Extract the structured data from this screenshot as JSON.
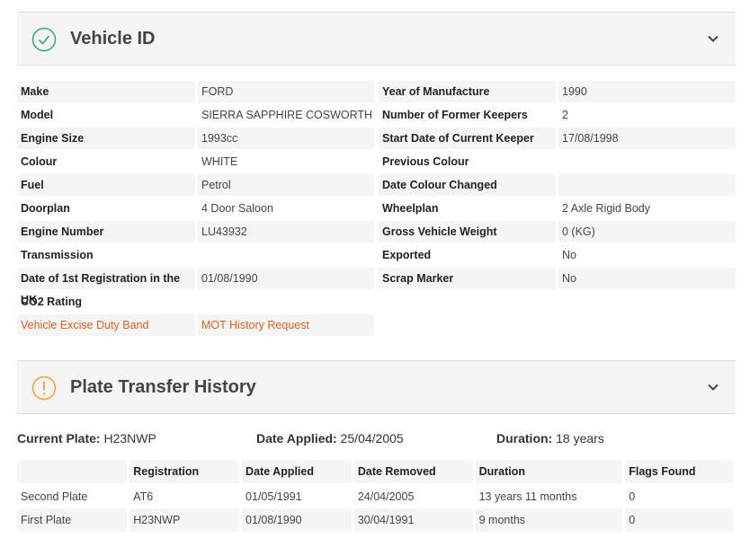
{
  "vehicle_id": {
    "title": "Vehicle ID",
    "rows": [
      {
        "l1": "Make",
        "v1": "FORD",
        "l2": "Year of Manufacture",
        "v2": "1990"
      },
      {
        "l1": "Model",
        "v1": "SIERRA SAPPHIRE COSWORTH",
        "l2": "Number of Former Keepers",
        "v2": "2"
      },
      {
        "l1": "Engine Size",
        "v1": "1993cc",
        "l2": "Start Date of Current Keeper",
        "v2": "17/08/1998"
      },
      {
        "l1": "Colour",
        "v1": "WHITE",
        "l2": "Previous Colour",
        "v2": ""
      },
      {
        "l1": "Fuel",
        "v1": "Petrol",
        "l2": "Date Colour Changed",
        "v2": ""
      },
      {
        "l1": "Doorplan",
        "v1": "4 Door Saloon",
        "l2": "Wheelplan",
        "v2": "2 Axle Rigid Body"
      },
      {
        "l1": "Engine Number",
        "v1": "LU43932",
        "l2": "Gross Vehicle Weight",
        "v2": "0 (KG)"
      },
      {
        "l1": "Transmission",
        "v1": "",
        "l2": "Exported",
        "v2": "No"
      },
      {
        "l1": "Date of 1st Registration in the UK",
        "v1": "01/08/1990",
        "l2": "Scrap Marker",
        "v2": "No"
      },
      {
        "l1": "CO2 Rating",
        "v1": "",
        "l2": "",
        "v2": ""
      }
    ],
    "links": {
      "ved_band": "Vehicle Excise Duty Band",
      "mot_history": "MOT History Request"
    }
  },
  "plate_transfer": {
    "title": "Plate Transfer History",
    "current_plate_label": "Current Plate:",
    "current_plate": "H23NWP",
    "date_applied_label": "Date Applied:",
    "date_applied": "25/04/2005",
    "duration_label": "Duration:",
    "duration": "18 years",
    "columns": [
      "",
      "Registration",
      "Date Applied",
      "Date Removed",
      "Duration",
      "Flags Found"
    ],
    "rows": [
      [
        "Second Plate",
        "AT6",
        "01/05/1991",
        "24/04/2005",
        "13 years 11 months",
        "0"
      ],
      [
        "First Plate",
        "H23NWP",
        "01/08/1990",
        "30/04/1991",
        "9 months",
        "0"
      ]
    ]
  },
  "colors": {
    "success": "#3aaa6e",
    "warning": "#f0a030",
    "link": "#e0601e"
  }
}
